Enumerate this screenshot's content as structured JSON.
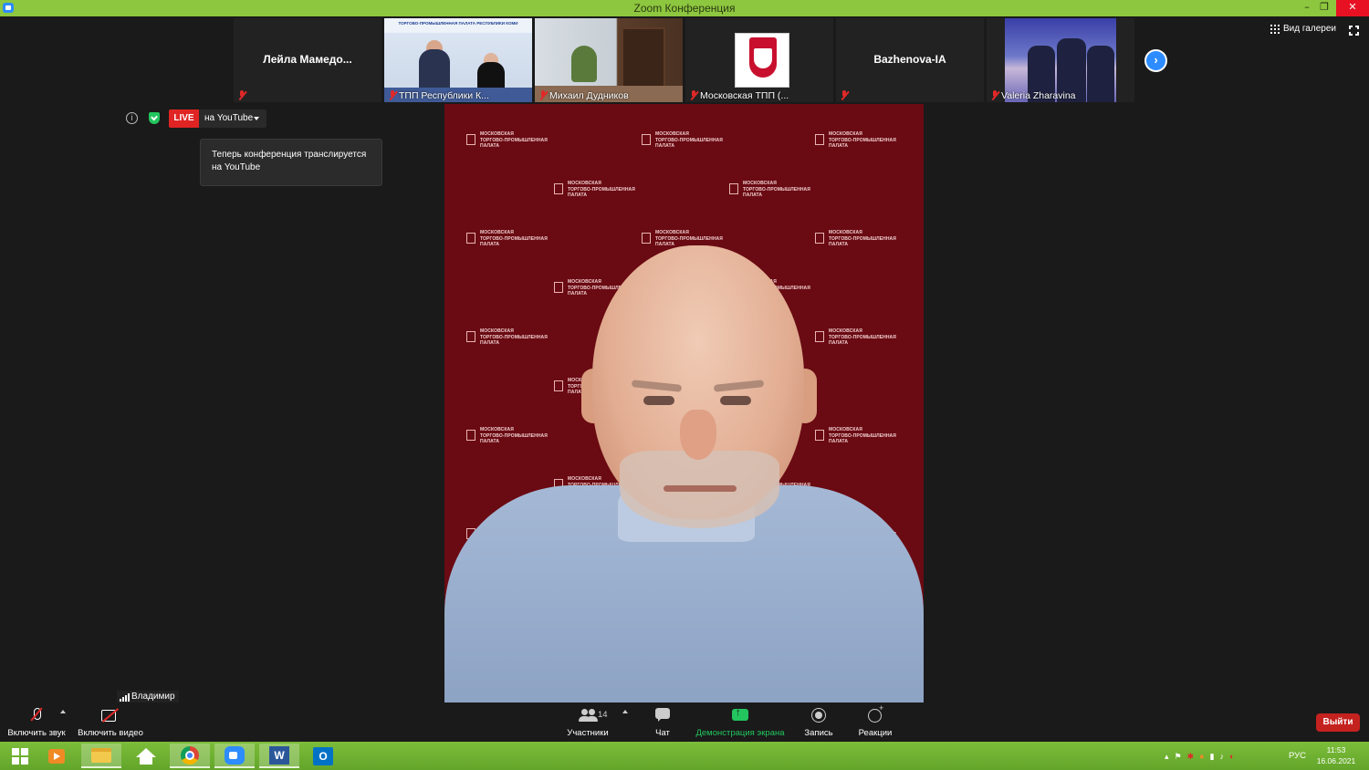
{
  "window": {
    "title": "Zoom Конференция",
    "controls": [
      "–",
      "❐",
      "✕"
    ]
  },
  "gallery_strip": {
    "tiles": [
      {
        "name": "Лейла  Мамедо...",
        "has_video": false,
        "muted": true
      },
      {
        "name": "ТПП Республики К...",
        "has_video": true,
        "muted": true,
        "banner": "ТОРГОВО-ПРОМЫШЛЕННАЯ ПАЛАТА РЕСПУБЛИКИ КОМИ"
      },
      {
        "name": "Михаил Дудников",
        "has_video": true,
        "muted": true
      },
      {
        "name": "Московская ТПП (...",
        "has_video": true,
        "muted": true
      },
      {
        "name": "Bazhenova-IA",
        "has_video": false,
        "muted": true
      },
      {
        "name": "Valeria Zharavina",
        "has_video": true,
        "muted": true
      }
    ],
    "next_icon": "chevron-right-icon"
  },
  "view_controls": {
    "gallery_view_label": "Вид галереи",
    "fullscreen_icon": "fullscreen-icon"
  },
  "stream": {
    "live_label": "LIVE",
    "platform_label": "на YouTube",
    "tooltip": "Теперь конференция транслируется на YouTube"
  },
  "speaker": {
    "background_logo_lines": [
      "МОСКОВСКАЯ",
      "ТОРГОВО-ПРОМЫШЛЕННАЯ",
      "ПАЛАТА"
    ]
  },
  "self_view": {
    "name": "Владимир"
  },
  "toolbar": {
    "mic_label": "Включить звук",
    "video_label": "Включить видео",
    "participants_label": "Участники",
    "participants_count": "14",
    "chat_label": "Чат",
    "share_label": "Демонстрация экрана",
    "record_label": "Запись",
    "reactions_label": "Реакции",
    "leave_label": "Выйти"
  },
  "colors": {
    "title_bar": "#8dc63f",
    "live_red": "#e02424",
    "share_green": "#23c55e",
    "leave_red": "#c4221f",
    "zoom_blue": "#2d8cff"
  },
  "taskbar": {
    "language": "РУС",
    "time": "11:53",
    "date": "16.06.2021"
  }
}
